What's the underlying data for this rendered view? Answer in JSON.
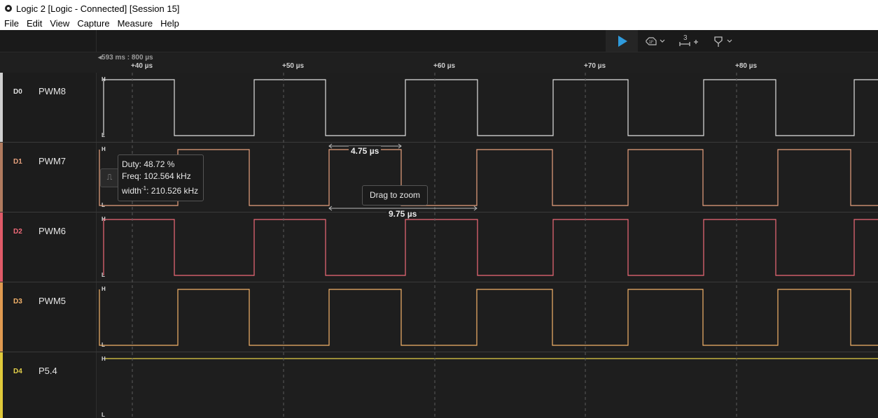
{
  "window": {
    "title": "Logic 2 [Logic - Connected] [Session 15]"
  },
  "menu": [
    "File",
    "Edit",
    "View",
    "Capture",
    "Measure",
    "Help"
  ],
  "toolbar": {
    "play_icon": "play-icon",
    "trigger_icon": "trigger-icon",
    "measure_label": "3",
    "marker_icon": "marker-icon",
    "accent": "#2f9bdc"
  },
  "timeline": {
    "origin": "593 ms : 800 µs",
    "ticks": [
      "+40 µs",
      "+50 µs",
      "+60 µs",
      "+70 µs",
      "+80 µs"
    ]
  },
  "channels": [
    {
      "id": "D0",
      "name": "PWM8",
      "color": "#e0e0e0",
      "strip": "#cfcfcf"
    },
    {
      "id": "D1",
      "name": "PWM7",
      "color": "#e8a27e",
      "strip": "#b07a5e"
    },
    {
      "id": "D2",
      "name": "PWM6",
      "color": "#f06a78",
      "strip": "#e05a68"
    },
    {
      "id": "D3",
      "name": "PWM5",
      "color": "#f5b36a",
      "strip": "#e09a50"
    },
    {
      "id": "D4",
      "name": "P5.4",
      "color": "#e6d24a",
      "strip": "#e0c93a"
    }
  ],
  "level_labels": {
    "high": "H",
    "low": "L"
  },
  "measurements": {
    "tooltip": {
      "duty": "Duty: 48.72 %",
      "freq": "Freq: 102.564 kHz",
      "width_prefix": "width",
      "width_sup": "-1",
      "width_value": ": 210.526 kHz"
    },
    "pulse_width": "4.75 µs",
    "period": "9.75 µs",
    "drag_hint": "Drag to zoom"
  }
}
